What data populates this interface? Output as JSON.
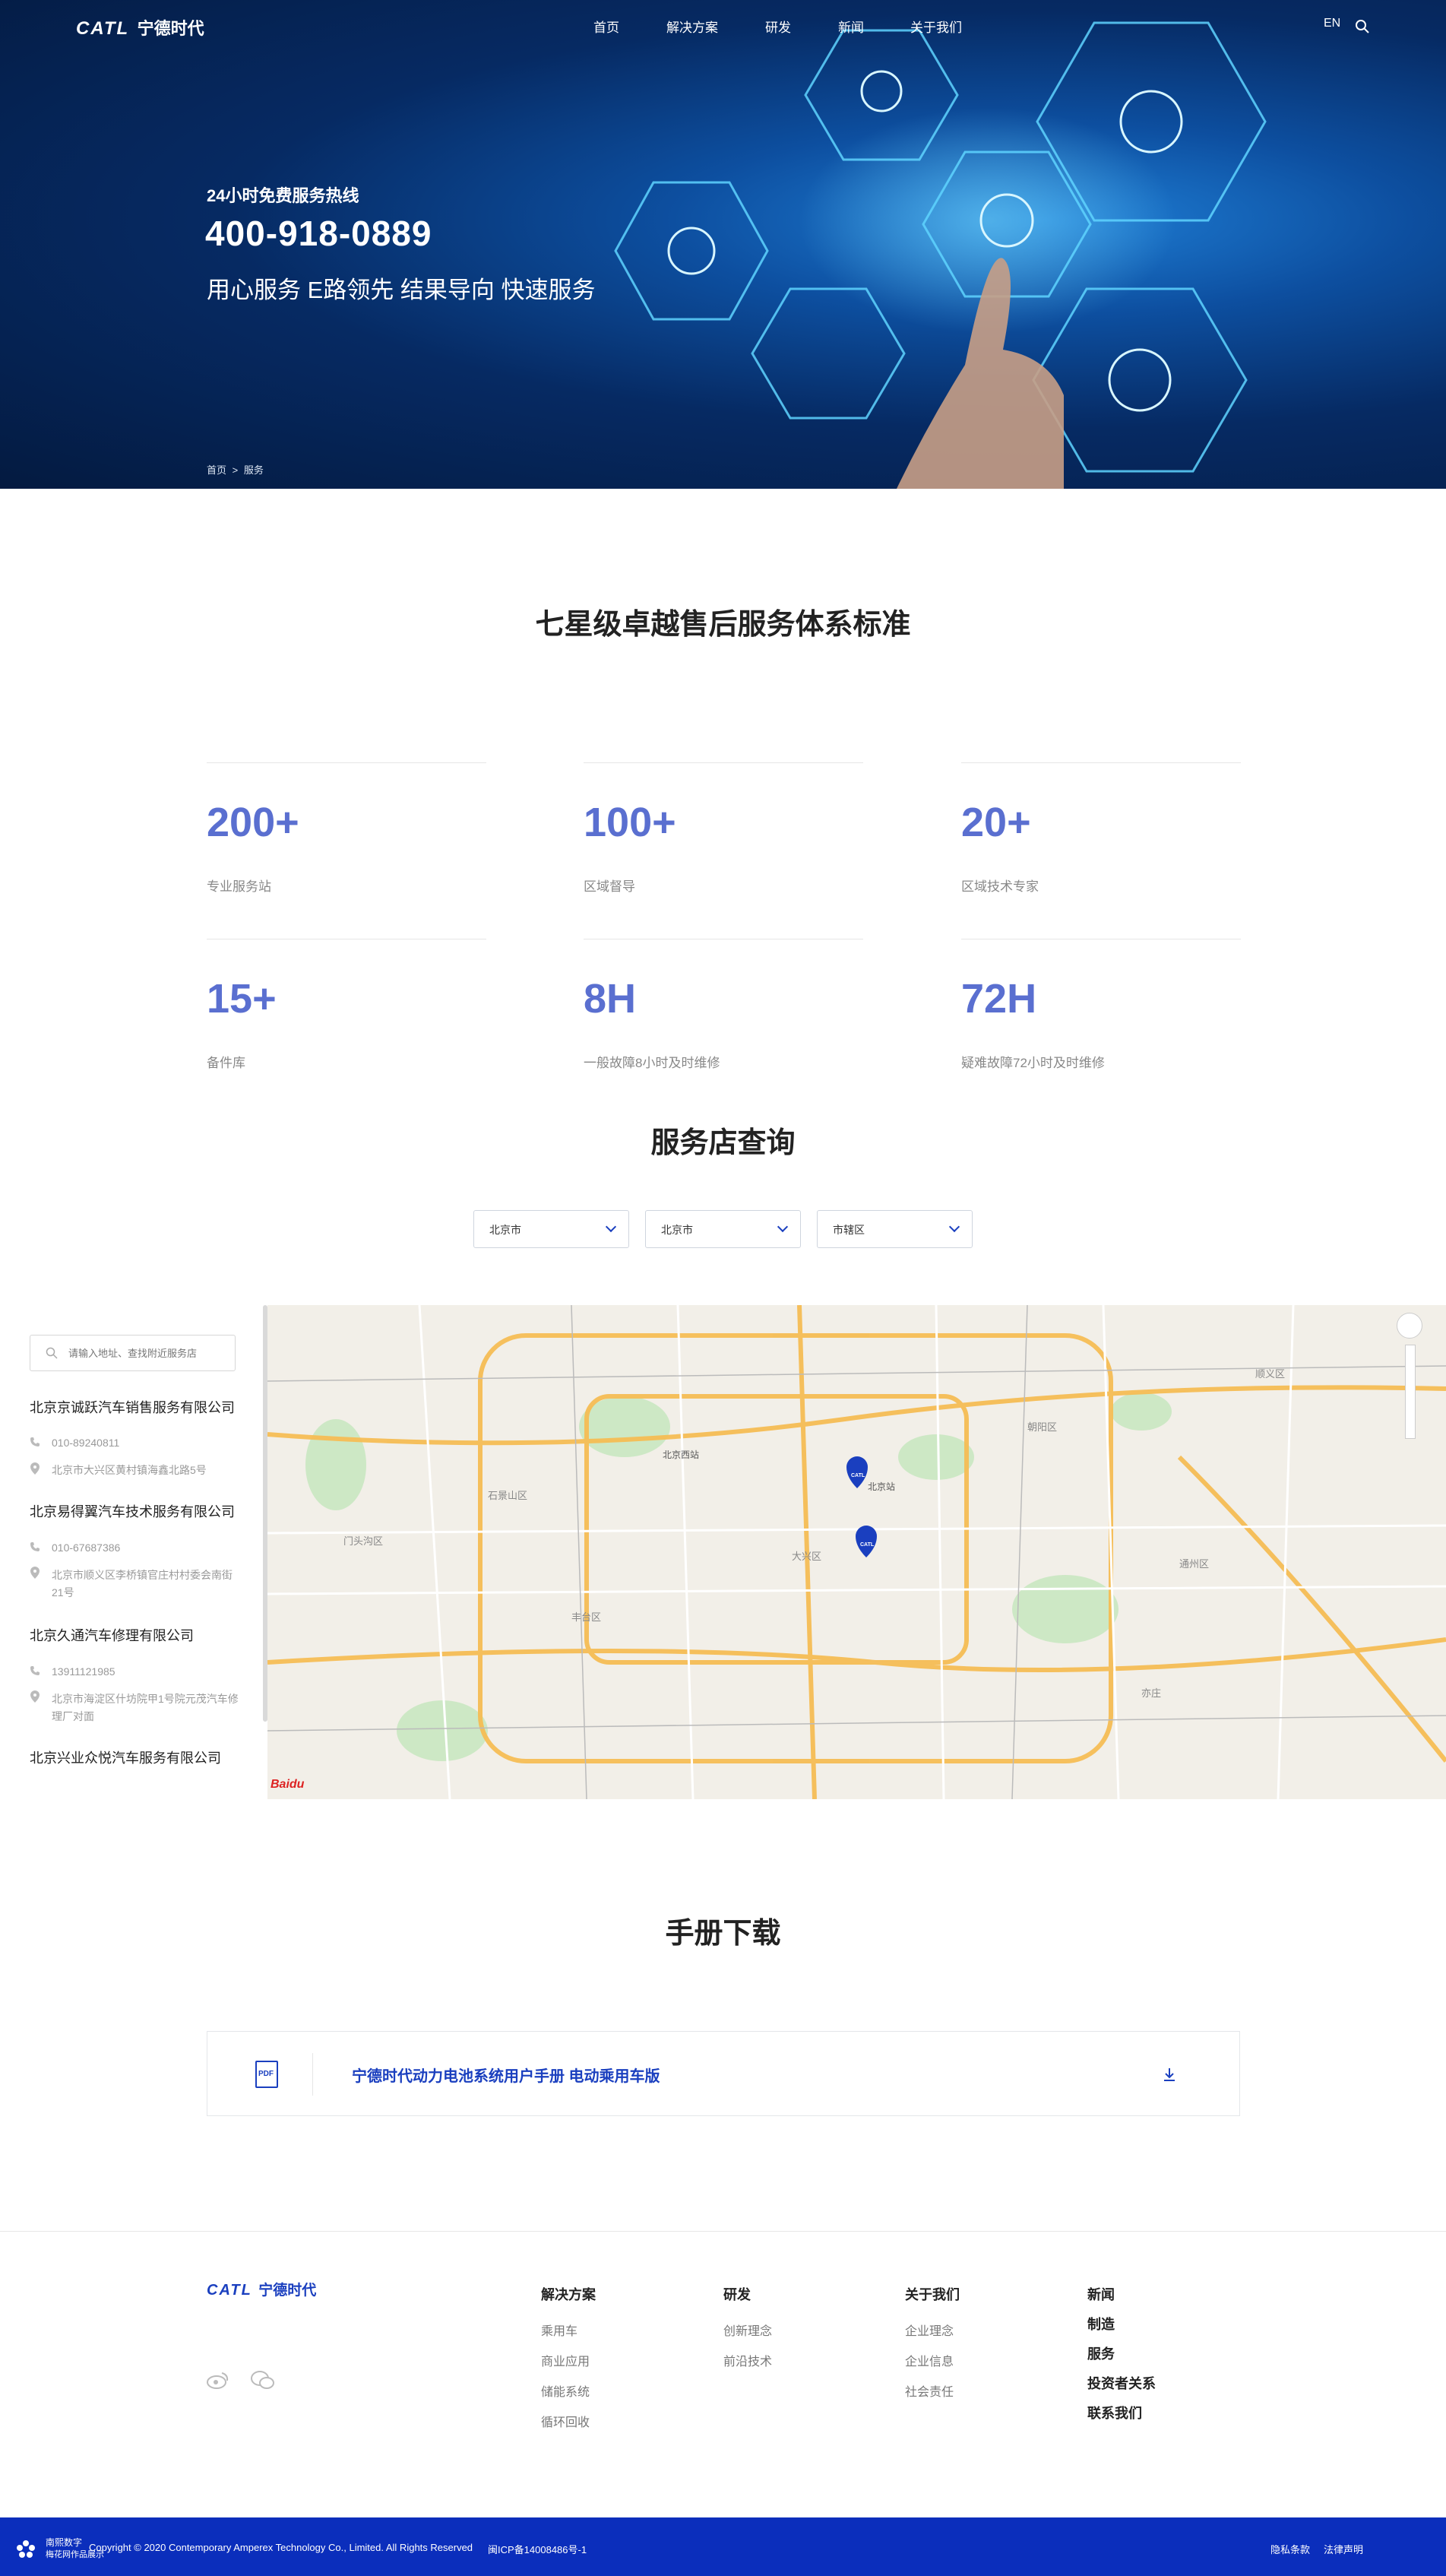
{
  "header": {
    "logo_en": "CATL",
    "logo_cn": "宁德时代",
    "nav": [
      "首页",
      "解决方案",
      "研发",
      "新闻",
      "关于我们"
    ],
    "lang": "EN"
  },
  "hero": {
    "hotline_label": "24小时免费服务热线",
    "phone": "400-918-0889",
    "slogan": "用心服务 E路领先 结果导向 快速服务",
    "breadcrumb": [
      "首页",
      "服务"
    ],
    "breadcrumb_sep": ">"
  },
  "standards": {
    "title": "七星级卓越售后服务体系标准",
    "stats": [
      {
        "value": "200+",
        "label": "专业服务站"
      },
      {
        "value": "100+",
        "label": "区域督导"
      },
      {
        "value": "20+",
        "label": "区域技术专家"
      },
      {
        "value": "15+",
        "label": "备件库"
      },
      {
        "value": "8H",
        "label": "一般故障8小时及时维修"
      },
      {
        "value": "72H",
        "label": "疑难故障72小时及时维修"
      }
    ]
  },
  "store_query": {
    "title": "服务店查询",
    "selects": [
      "北京市",
      "北京市",
      "市辖区"
    ],
    "search_placeholder": "请输入地址、查找附近服务店",
    "stores": [
      {
        "name": "北京京诚跃汽车销售服务有限公司",
        "phone": "010-89240811",
        "address": "北京市大兴区黄村镇海鑫北路5号"
      },
      {
        "name": "北京易得翼汽车技术服务有限公司",
        "phone": "010-67687386",
        "address": "北京市顺义区李桥镇官庄村村委会南街21号"
      },
      {
        "name": "北京久通汽车修理有限公司",
        "phone": "13911121985",
        "address": "北京市海淀区什坊院甲1号院元茂汽车修理厂对面"
      },
      {
        "name": "北京兴业众悦汽车服务有限公司",
        "phone": "",
        "address": ""
      }
    ],
    "map_labels": [
      "北京西站",
      "北京站",
      "大兴区",
      "石景山区",
      "门头沟区",
      "通州区",
      "朝阳区",
      "丰台区",
      "顺义区",
      "亦庄",
      "CATL"
    ],
    "map_brand": "Baidu"
  },
  "manual": {
    "title": "手册下载",
    "items": [
      {
        "icon_text": "PDF",
        "name": "宁德时代动力电池系统用户手册 电动乘用车版"
      }
    ]
  },
  "footer": {
    "logo_en": "CATL",
    "logo_cn": "宁德时代",
    "columns": [
      {
        "heading": "解决方案",
        "items": [
          "乘用车",
          "商业应用",
          "储能系统",
          "循环回收"
        ]
      },
      {
        "heading": "研发",
        "items": [
          "创新理念",
          "前沿技术"
        ]
      },
      {
        "heading": "关于我们",
        "items": [
          "企业理念",
          "企业信息",
          "社会责任"
        ]
      }
    ],
    "standalone": [
      "新闻",
      "制造",
      "服务",
      "投资者关系",
      "联系我们"
    ],
    "copyright": "Copyright © 2020 Contemporary Amperex Technology Co., Limited. All Rights Reserved",
    "icp": "闽ICP备14008486号-1",
    "badge_line1": "南熙数字",
    "badge_line2": "梅花网作品展示",
    "legal": [
      "隐私条款",
      "法律声明"
    ]
  },
  "colors": {
    "accent": "#5a6fd0",
    "brand": "#0b2ebc",
    "link": "#1a3fbf"
  }
}
